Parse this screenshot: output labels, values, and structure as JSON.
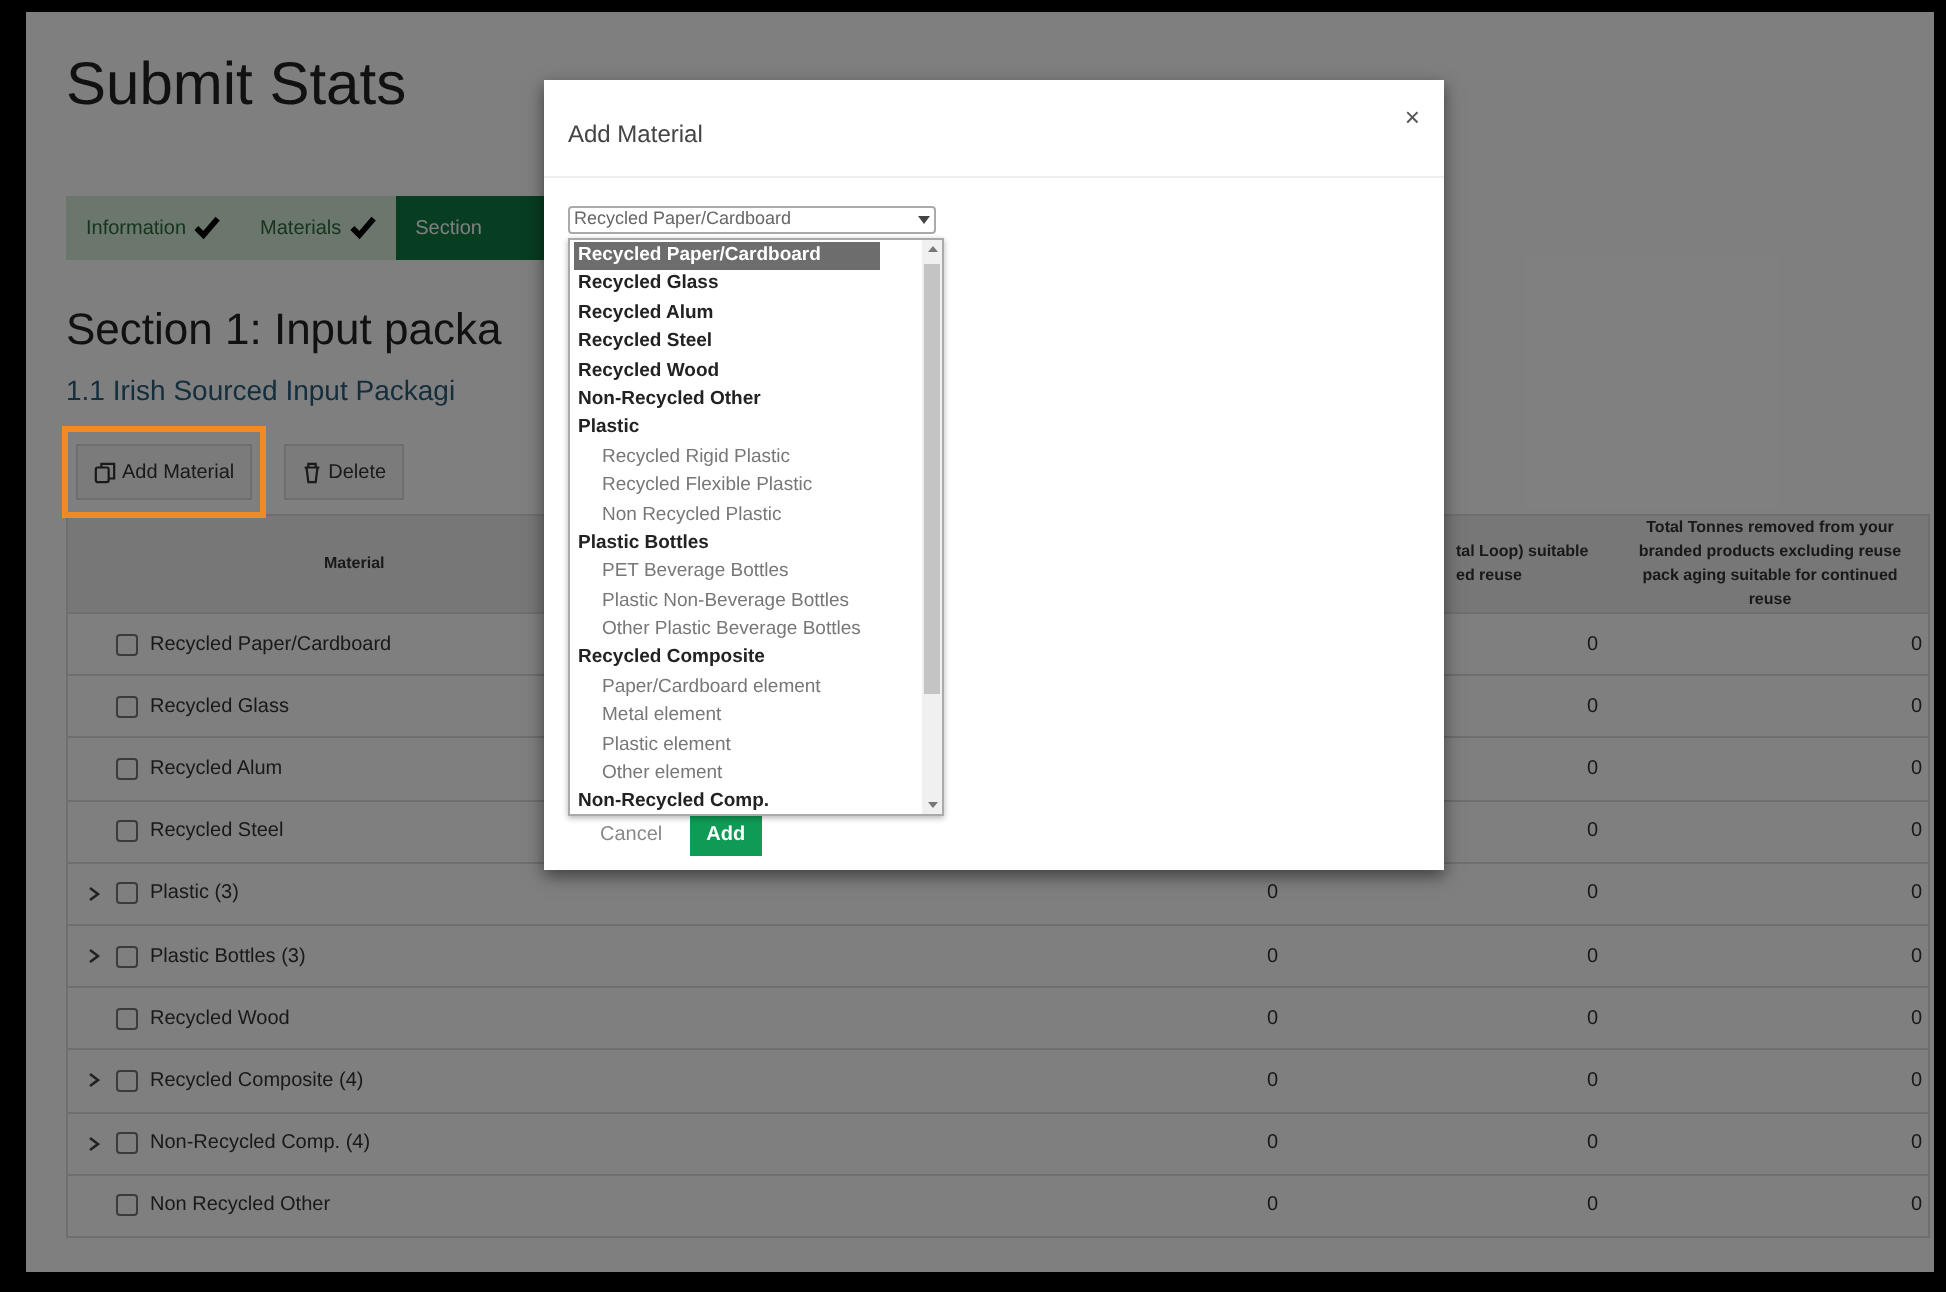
{
  "page": {
    "title": "Submit Stats"
  },
  "steps": [
    {
      "label": "Information",
      "done": true,
      "selected": false
    },
    {
      "label": "Materials",
      "done": true,
      "selected": false
    },
    {
      "label": "Section",
      "done": false,
      "selected": true
    }
  ],
  "section_heading": "Section 1: Input packa",
  "subsection_heading": "1.1 Irish Sourced Input Packagi",
  "toolbar": [
    {
      "label": "Add Material",
      "kind": "add",
      "highlighted": true
    },
    {
      "label": "Delete",
      "kind": "delete",
      "highlighted": false
    }
  ],
  "table": {
    "columns": {
      "material": "Material",
      "column_3": "tal Loop) suitable ed reuse",
      "column_4": "Total Tonnes removed from your branded products excluding reuse pack aging suitable for continued reuse"
    },
    "rows": [
      {
        "name": "Recycled Paper/Cardboard",
        "expandable": false,
        "checked": false,
        "column_3": "0",
        "column_4": "0"
      },
      {
        "name": "Recycled Glass",
        "expandable": false,
        "checked": false,
        "column_3": "0",
        "column_4": "0"
      },
      {
        "name": "Recycled Alum",
        "expandable": false,
        "checked": false,
        "column_3": "0",
        "column_4": "0"
      },
      {
        "name": "Recycled Steel",
        "expandable": false,
        "checked": false,
        "column_3": "0",
        "column_4": "0"
      },
      {
        "name": "Plastic (3)",
        "expandable": true,
        "checked": false,
        "column_2": "0",
        "column_3": "0",
        "column_4": "0"
      },
      {
        "name": "Plastic Bottles (3)",
        "expandable": true,
        "checked": false,
        "column_2": "0",
        "column_3": "0",
        "column_4": "0"
      },
      {
        "name": "Recycled Wood",
        "expandable": false,
        "checked": false,
        "column_2": "0",
        "column_3": "0",
        "column_4": "0"
      },
      {
        "name": "Recycled Composite (4)",
        "expandable": true,
        "checked": false,
        "column_2": "0",
        "column_3": "0",
        "column_4": "0"
      },
      {
        "name": "Non-Recycled Comp. (4)",
        "expandable": true,
        "checked": false,
        "column_2": "0",
        "column_3": "0",
        "column_4": "0"
      },
      {
        "name": "Non Recycled Other",
        "expandable": false,
        "checked": false,
        "column_2": "0",
        "column_3": "0",
        "column_4": "0"
      }
    ]
  },
  "modal": {
    "title": "Add Material",
    "close": "×",
    "select": {
      "value": "Recycled Paper/Cardboard",
      "options": [
        {
          "label": "Recycled Paper/Cardboard",
          "kind": "option",
          "selected": true
        },
        {
          "label": "Recycled Glass",
          "kind": "option",
          "selected": false
        },
        {
          "label": "Recycled Alum",
          "kind": "option",
          "selected": false
        },
        {
          "label": "Recycled Steel",
          "kind": "option",
          "selected": false
        },
        {
          "label": "Recycled Wood",
          "kind": "option",
          "selected": false
        },
        {
          "label": "Non-Recycled Other",
          "kind": "option",
          "selected": false
        },
        {
          "label": "Plastic",
          "kind": "group",
          "selected": false
        },
        {
          "label": "Recycled Rigid Plastic",
          "kind": "child",
          "selected": false
        },
        {
          "label": "Recycled Flexible Plastic",
          "kind": "child",
          "selected": false
        },
        {
          "label": "Non Recycled Plastic",
          "kind": "child",
          "selected": false
        },
        {
          "label": "Plastic Bottles",
          "kind": "group",
          "selected": false
        },
        {
          "label": "PET Beverage Bottles",
          "kind": "child",
          "selected": false
        },
        {
          "label": "Plastic Non-Beverage Bottles",
          "kind": "child",
          "selected": false
        },
        {
          "label": "Other Plastic Beverage Bottles",
          "kind": "child",
          "selected": false
        },
        {
          "label": "Recycled Composite",
          "kind": "group",
          "selected": false
        },
        {
          "label": "Paper/Cardboard element",
          "kind": "child",
          "selected": false
        },
        {
          "label": "Metal element",
          "kind": "child",
          "selected": false
        },
        {
          "label": "Plastic element",
          "kind": "child",
          "selected": false
        },
        {
          "label": "Other element",
          "kind": "child",
          "selected": false
        },
        {
          "label": "Non-Recycled Comp.",
          "kind": "group",
          "selected": false
        }
      ]
    },
    "buttons": [
      {
        "label": "Cancel",
        "kind": "secondary"
      },
      {
        "label": "Add",
        "kind": "primary"
      }
    ]
  }
}
